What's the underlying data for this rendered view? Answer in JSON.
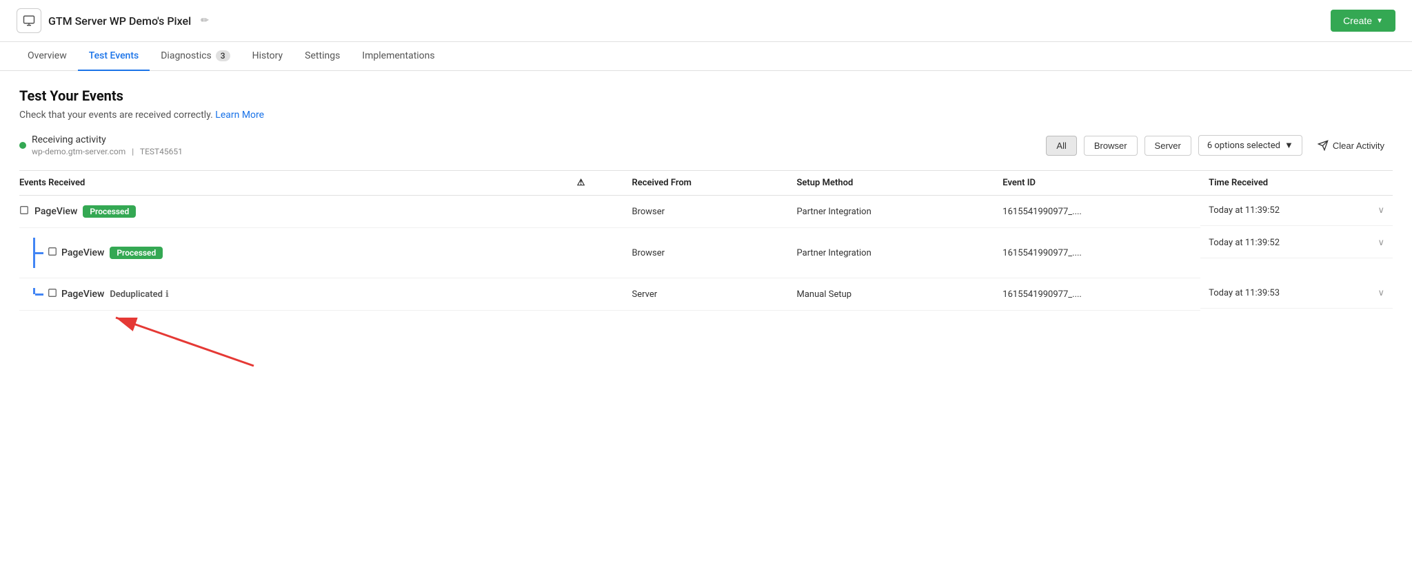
{
  "header": {
    "icon_label": "monitor",
    "title": "GTM Server WP Demo's Pixel",
    "edit_icon": "✏",
    "create_label": "Create",
    "create_chevron": "▼"
  },
  "nav": {
    "tabs": [
      {
        "id": "overview",
        "label": "Overview",
        "active": false,
        "badge": null
      },
      {
        "id": "test-events",
        "label": "Test Events",
        "active": true,
        "badge": null
      },
      {
        "id": "diagnostics",
        "label": "Diagnostics",
        "active": false,
        "badge": "3"
      },
      {
        "id": "history",
        "label": "History",
        "active": false,
        "badge": null
      },
      {
        "id": "settings",
        "label": "Settings",
        "active": false,
        "badge": null
      },
      {
        "id": "implementations",
        "label": "Implementations",
        "active": false,
        "badge": null
      }
    ]
  },
  "page": {
    "title": "Test Your Events",
    "subtitle": "Check that your events are received correctly.",
    "learn_more": "Learn More"
  },
  "activity": {
    "status_label": "Receiving activity",
    "meta_domain": "wp-demo.gtm-server.com",
    "meta_separator": "|",
    "meta_id": "TEST45651",
    "filters": {
      "all": "All",
      "browser": "Browser",
      "server": "Server"
    },
    "options_label": "6 options selected",
    "clear_label": "Clear Activity"
  },
  "table": {
    "columns": [
      "Events Received",
      "⚠",
      "Received From",
      "Setup Method",
      "Event ID",
      "Time Received"
    ],
    "rows": [
      {
        "id": "row1",
        "name": "PageView",
        "status": "Processed",
        "status_type": "processed",
        "received_from": "Browser",
        "setup_method": "Partner Integration",
        "event_id": "1615541990977_....",
        "time_received": "Today at 11:39:52",
        "indent": 0,
        "children": true
      },
      {
        "id": "row2",
        "name": "PageView",
        "status": "Processed",
        "status_type": "processed",
        "received_from": "Browser",
        "setup_method": "Partner Integration",
        "event_id": "1615541990977_....",
        "time_received": "Today at 11:39:52",
        "indent": 1,
        "children": false,
        "last_child": false
      },
      {
        "id": "row3",
        "name": "PageView",
        "status": "Deduplicated",
        "status_type": "deduplicated",
        "received_from": "Server",
        "setup_method": "Manual Setup",
        "event_id": "1615541990977_....",
        "time_received": "Today at 11:39:53",
        "indent": 1,
        "children": false,
        "last_child": true
      }
    ]
  },
  "annotation": {
    "arrow_points_to": "Deduplicated status"
  }
}
